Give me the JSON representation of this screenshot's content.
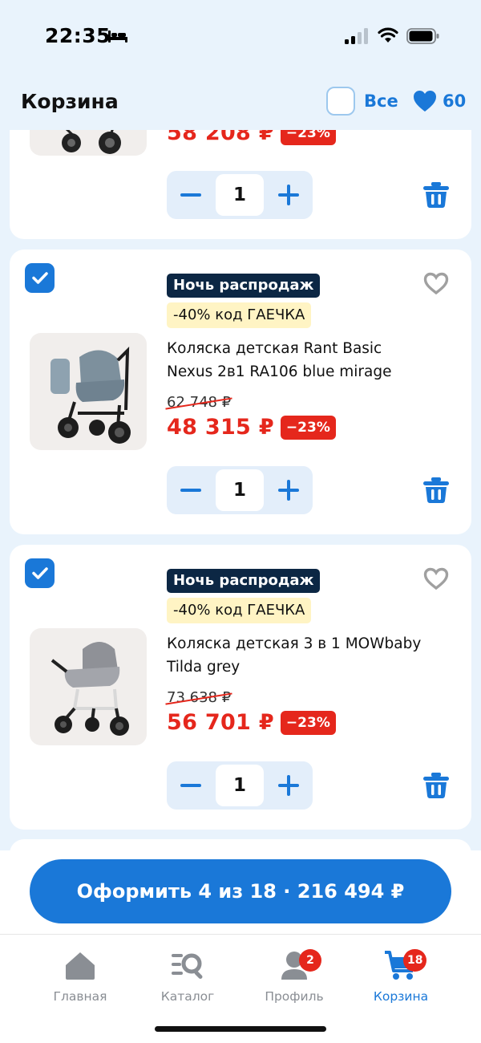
{
  "status_bar": {
    "time": "22:35"
  },
  "header": {
    "title": "Корзина",
    "select_all_label": "Все",
    "favorites_count": "60"
  },
  "items": [
    {
      "price": "58 208 ₽",
      "discount": "−23%",
      "quantity": "1",
      "selected": true
    },
    {
      "badge_sale": "Ночь распродаж",
      "badge_promo": "-40% код ГАЕЧКА",
      "title": "Коляска детская Rant Basic Nexus 2в1 RA106 blue mirage",
      "old_price": "62 748 ₽",
      "price": "48 315 ₽",
      "discount": "−23%",
      "quantity": "1",
      "selected": true,
      "color": "#7d909d"
    },
    {
      "badge_sale": "Ночь распродаж",
      "badge_promo": "-40% код ГАЕЧКА",
      "title": "Коляска детская 3 в 1 MOWbaby Tilda grey",
      "old_price": "73 638 ₽",
      "price": "56 701 ₽",
      "discount": "−23%",
      "quantity": "1",
      "selected": true,
      "color": "#8f9197"
    }
  ],
  "checkout": {
    "label": "Оформить 4 из 18 · 216 494 ₽"
  },
  "tabbar": {
    "tabs": [
      {
        "label": "Главная",
        "icon": "home-icon",
        "badge": ""
      },
      {
        "label": "Каталог",
        "icon": "catalog-search-icon",
        "badge": ""
      },
      {
        "label": "Профиль",
        "icon": "profile-icon",
        "badge": "2"
      },
      {
        "label": "Корзина",
        "icon": "cart-icon",
        "badge": "18",
        "active": true
      }
    ]
  },
  "colors": {
    "accent": "#1a78d8",
    "sale_red": "#e5271c",
    "dark_badge": "#0c2744",
    "promo_yellow": "#fff4c4",
    "background": "#e9f3fc"
  }
}
